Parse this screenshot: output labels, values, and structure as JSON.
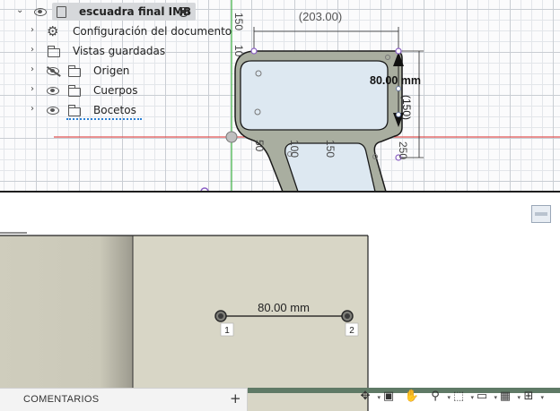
{
  "browser": {
    "root_item": "escuadra final IMB",
    "items": [
      {
        "label": "Configuración del documento",
        "icon": "gear-icon"
      },
      {
        "label": "Vistas guardadas",
        "icon": "folder-icon"
      },
      {
        "label": "Origen",
        "icon": "folder-icon"
      },
      {
        "label": "Cuerpos",
        "icon": "folder-icon"
      },
      {
        "label": "Bocetos",
        "icon": "folder-icon"
      }
    ]
  },
  "sketch": {
    "dim_top": "(203.00)",
    "dim_side": "80.00 mm",
    "dim_vertical": "(150)",
    "axis_labels": {
      "v150": "150",
      "v10": "10",
      "h50": "50",
      "h100": "100",
      "h150": "150",
      "h250": "250"
    }
  },
  "model": {
    "measure": "80.00 mm",
    "point1": "1",
    "point2": "2"
  },
  "comments": {
    "label": "COMENTARIOS",
    "add": "+"
  },
  "colors": {
    "x_axis": "#e05050",
    "y_axis": "#3cb043",
    "sketch_line": "#1a1a1a",
    "profile_fill": "#a9aea0",
    "inner_fill": "#dde8f1",
    "face": "#d8d6c6",
    "face_side": "#cfcdbd",
    "handle_purple": "#8a5fc4"
  }
}
